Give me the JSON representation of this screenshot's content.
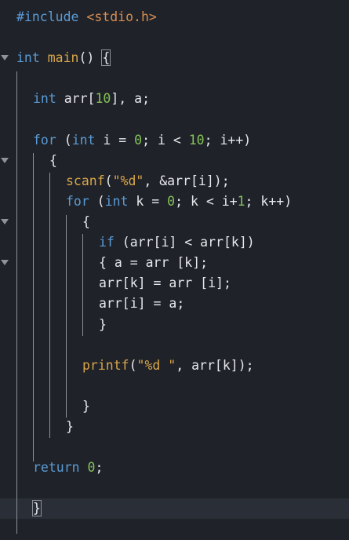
{
  "editor": {
    "language": "c",
    "lines": [
      {
        "tokens": [
          {
            "t": "#include",
            "c": "kw"
          },
          {
            "t": " ",
            "c": ""
          },
          {
            "t": "<stdio.h>",
            "c": "inc"
          }
        ]
      },
      {
        "tokens": []
      },
      {
        "fold": true,
        "tokens": [
          {
            "t": "int",
            "c": "kw"
          },
          {
            "t": " ",
            "c": ""
          },
          {
            "t": "main",
            "c": "fn"
          },
          {
            "t": "() ",
            "c": ""
          },
          {
            "t": "{",
            "c": "",
            "box": true
          }
        ]
      },
      {
        "tokens": []
      },
      {
        "tokens": [
          {
            "t": "int",
            "c": "kw"
          },
          {
            "t": " arr[",
            "c": ""
          },
          {
            "t": "10",
            "c": "num"
          },
          {
            "t": "], a;",
            "c": ""
          }
        ]
      },
      {
        "tokens": []
      },
      {
        "tokens": [
          {
            "t": "for",
            "c": "kw"
          },
          {
            "t": " (",
            "c": ""
          },
          {
            "t": "int",
            "c": "kw"
          },
          {
            "t": " i = ",
            "c": ""
          },
          {
            "t": "0",
            "c": "num"
          },
          {
            "t": "; i < ",
            "c": ""
          },
          {
            "t": "10",
            "c": "num"
          },
          {
            "t": "; i++)",
            "c": ""
          }
        ]
      },
      {
        "fold": true,
        "tokens": [
          {
            "t": "{",
            "c": ""
          }
        ]
      },
      {
        "tokens": [
          {
            "t": "scanf",
            "c": "fn"
          },
          {
            "t": "(",
            "c": ""
          },
          {
            "t": "\"%d\"",
            "c": "str"
          },
          {
            "t": ", &arr[i]);",
            "c": ""
          }
        ]
      },
      {
        "tokens": [
          {
            "t": "for",
            "c": "kw"
          },
          {
            "t": " (",
            "c": ""
          },
          {
            "t": "int",
            "c": "kw"
          },
          {
            "t": " k = ",
            "c": ""
          },
          {
            "t": "0",
            "c": "num"
          },
          {
            "t": "; k < i+",
            "c": ""
          },
          {
            "t": "1",
            "c": "num"
          },
          {
            "t": "; k++)",
            "c": ""
          }
        ]
      },
      {
        "fold": true,
        "tokens": [
          {
            "t": "{",
            "c": ""
          }
        ]
      },
      {
        "tokens": [
          {
            "t": "if",
            "c": "kw"
          },
          {
            "t": " (arr[i] < arr[k])",
            "c": ""
          }
        ]
      },
      {
        "fold": true,
        "tokens": [
          {
            "t": "{ a = arr [k];",
            "c": ""
          }
        ]
      },
      {
        "tokens": [
          {
            "t": "arr[k] = arr [i];",
            "c": ""
          }
        ]
      },
      {
        "tokens": [
          {
            "t": "arr[i] = a;",
            "c": ""
          }
        ]
      },
      {
        "tokens": [
          {
            "t": "}",
            "c": ""
          }
        ]
      },
      {
        "tokens": []
      },
      {
        "tokens": [
          {
            "t": "printf",
            "c": "fn"
          },
          {
            "t": "(",
            "c": ""
          },
          {
            "t": "\"%d \"",
            "c": "str"
          },
          {
            "t": ", arr[k]);",
            "c": ""
          }
        ]
      },
      {
        "tokens": []
      },
      {
        "tokens": [
          {
            "t": "}",
            "c": ""
          }
        ]
      },
      {
        "tokens": [
          {
            "t": "}",
            "c": ""
          }
        ]
      },
      {
        "tokens": []
      },
      {
        "tokens": [
          {
            "t": "return",
            "c": "kw"
          },
          {
            "t": " ",
            "c": ""
          },
          {
            "t": "0",
            "c": "num"
          },
          {
            "t": ";",
            "c": ""
          }
        ]
      },
      {
        "tokens": []
      },
      {
        "current": true,
        "tokens": [
          {
            "t": "}",
            "c": "",
            "box": true
          }
        ]
      },
      {
        "tokens": []
      }
    ]
  },
  "colors": {
    "background": "#1f2228",
    "keyword": "#5b9bd5",
    "function": "#d9a64a",
    "number": "#84c259",
    "string": "#d9a64a",
    "include": "#d98e52",
    "text": "#e6e8ec"
  }
}
